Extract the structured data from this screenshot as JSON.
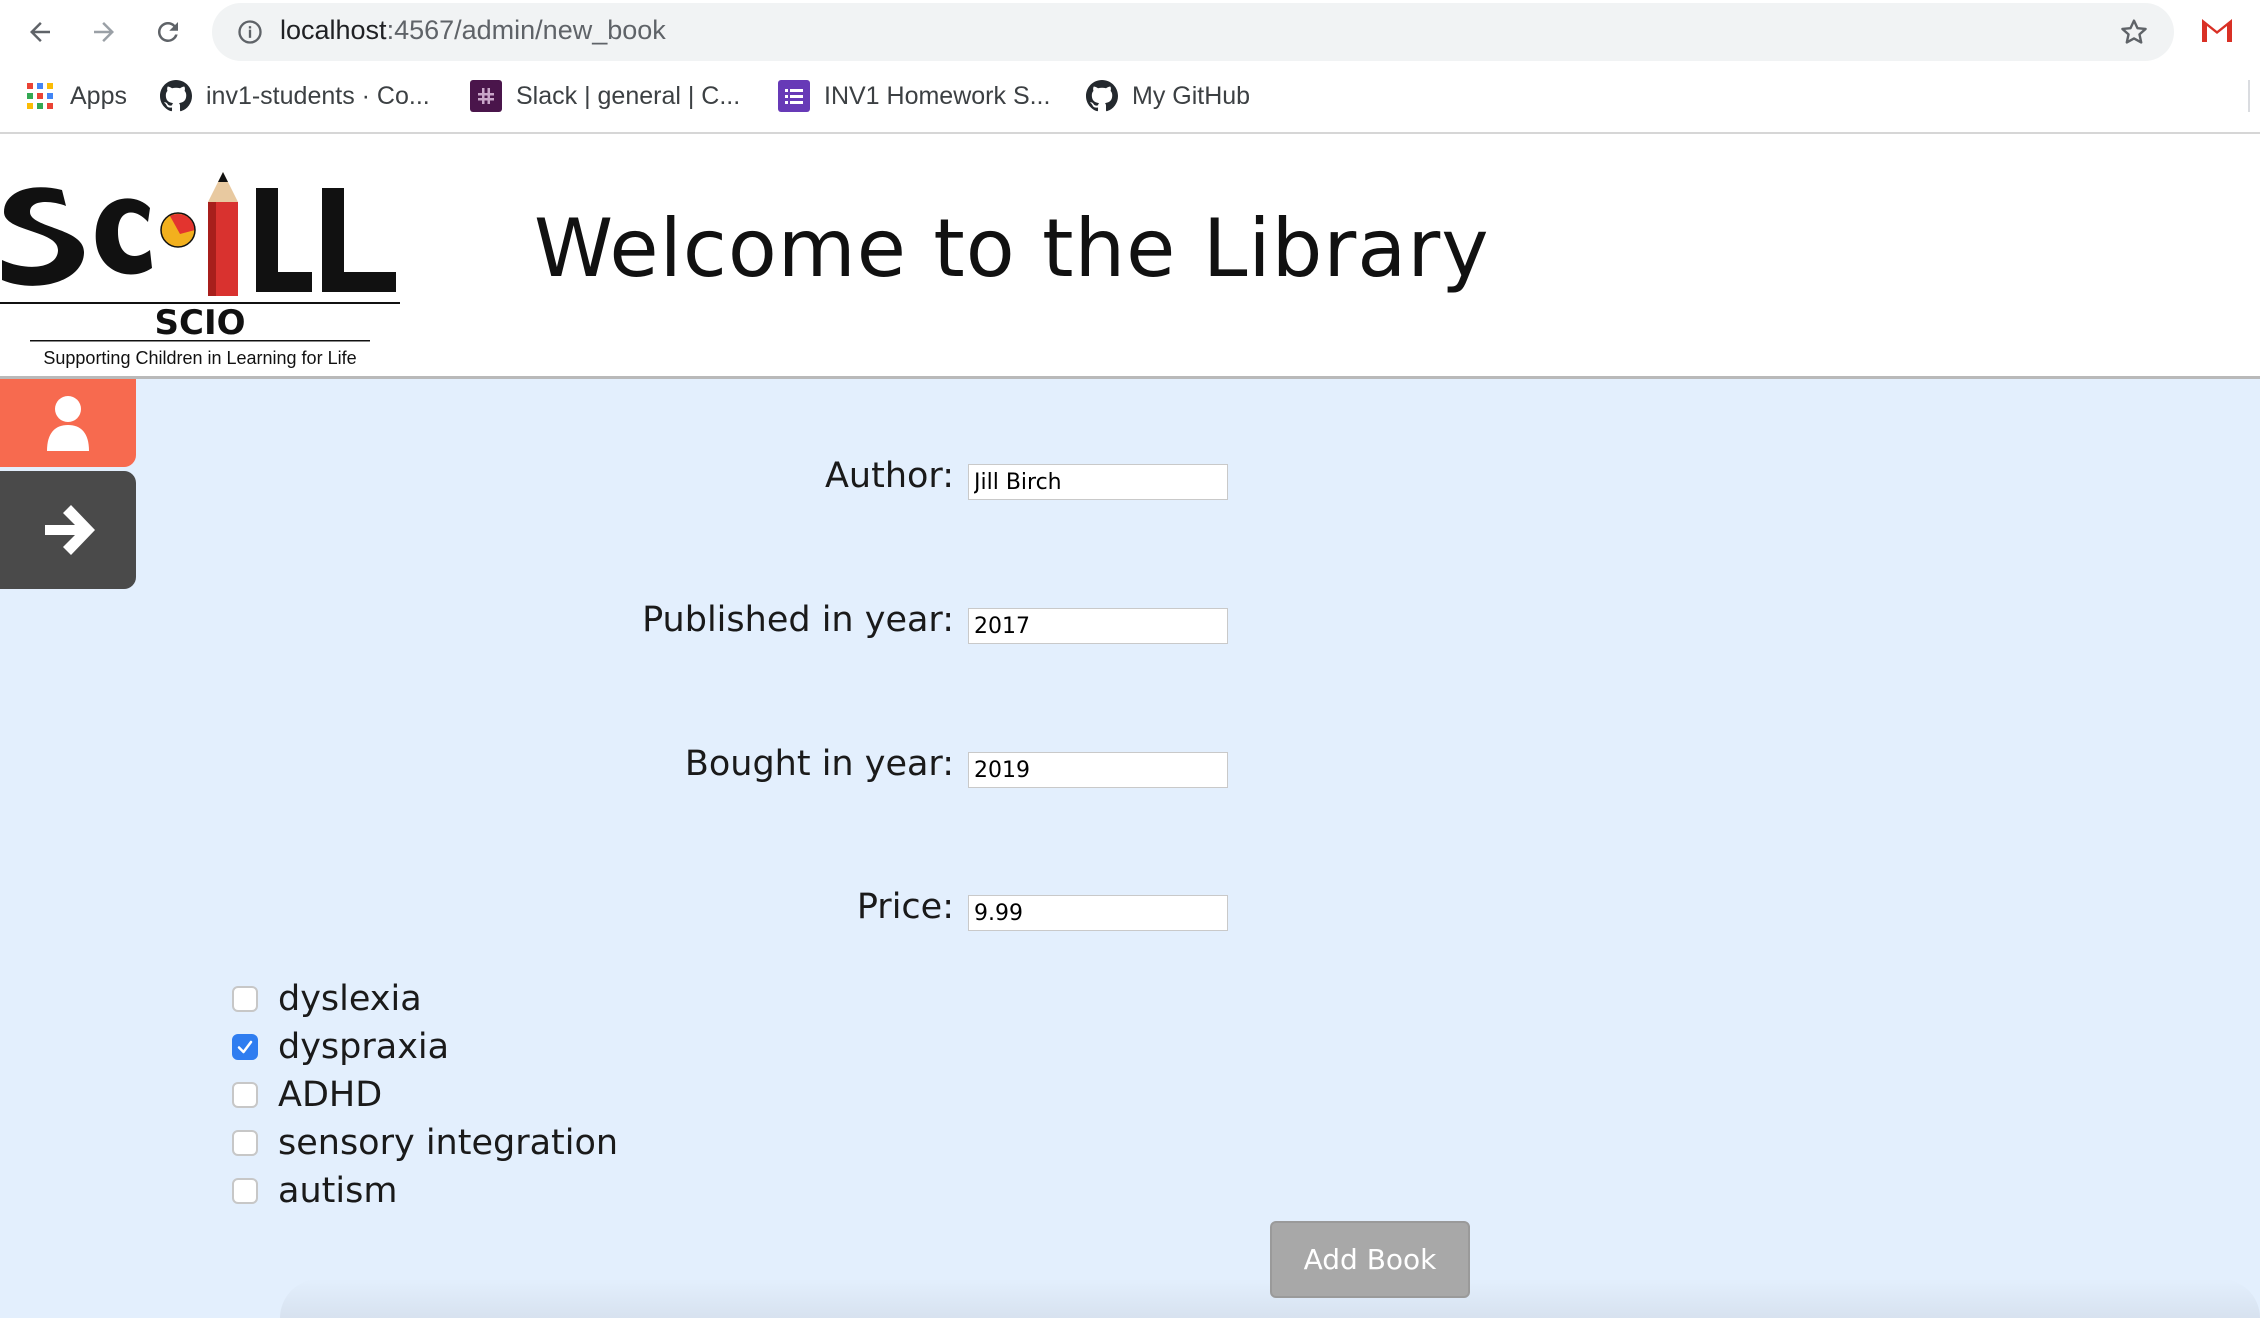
{
  "browser": {
    "url_host": "localhost",
    "url_path": ":4567/admin/new_book",
    "bookmarks": [
      {
        "label": "Apps",
        "icon": "apps-grid-icon"
      },
      {
        "label": "inv1-students · Co...",
        "icon": "github-icon"
      },
      {
        "label": "Slack | general | C...",
        "icon": "slack-icon"
      },
      {
        "label": "INV1 Homework S...",
        "icon": "forms-icon"
      },
      {
        "label": "My GitHub",
        "icon": "github-icon"
      }
    ]
  },
  "header": {
    "logo": {
      "wordmark": "SCILL",
      "sub": "SCIO",
      "tagline": "Supporting Children in Learning for Life"
    },
    "title": "Welcome to the Library"
  },
  "sidebar": {
    "user_icon": "user-icon",
    "next_icon": "arrow-right-icon"
  },
  "form": {
    "fields": [
      {
        "label": "Author:",
        "value": "Jill Birch"
      },
      {
        "label": "Published in year:",
        "value": "2017"
      },
      {
        "label": "Bought in year:",
        "value": "2019"
      },
      {
        "label": "Price:",
        "value": "9.99"
      }
    ],
    "checkboxes": [
      {
        "label": "dyslexia",
        "checked": false
      },
      {
        "label": "dyspraxia",
        "checked": true
      },
      {
        "label": "ADHD",
        "checked": false
      },
      {
        "label": "sensory integration",
        "checked": false
      },
      {
        "label": "autism",
        "checked": false
      }
    ],
    "submit_label": "Add Book"
  },
  "colors": {
    "page_bg": "#e3effd",
    "sidebar_user": "#f76a4f",
    "sidebar_next": "#4a4a4a",
    "button_bg": "#a8a8a8",
    "checkbox_checked": "#2f7df0"
  }
}
